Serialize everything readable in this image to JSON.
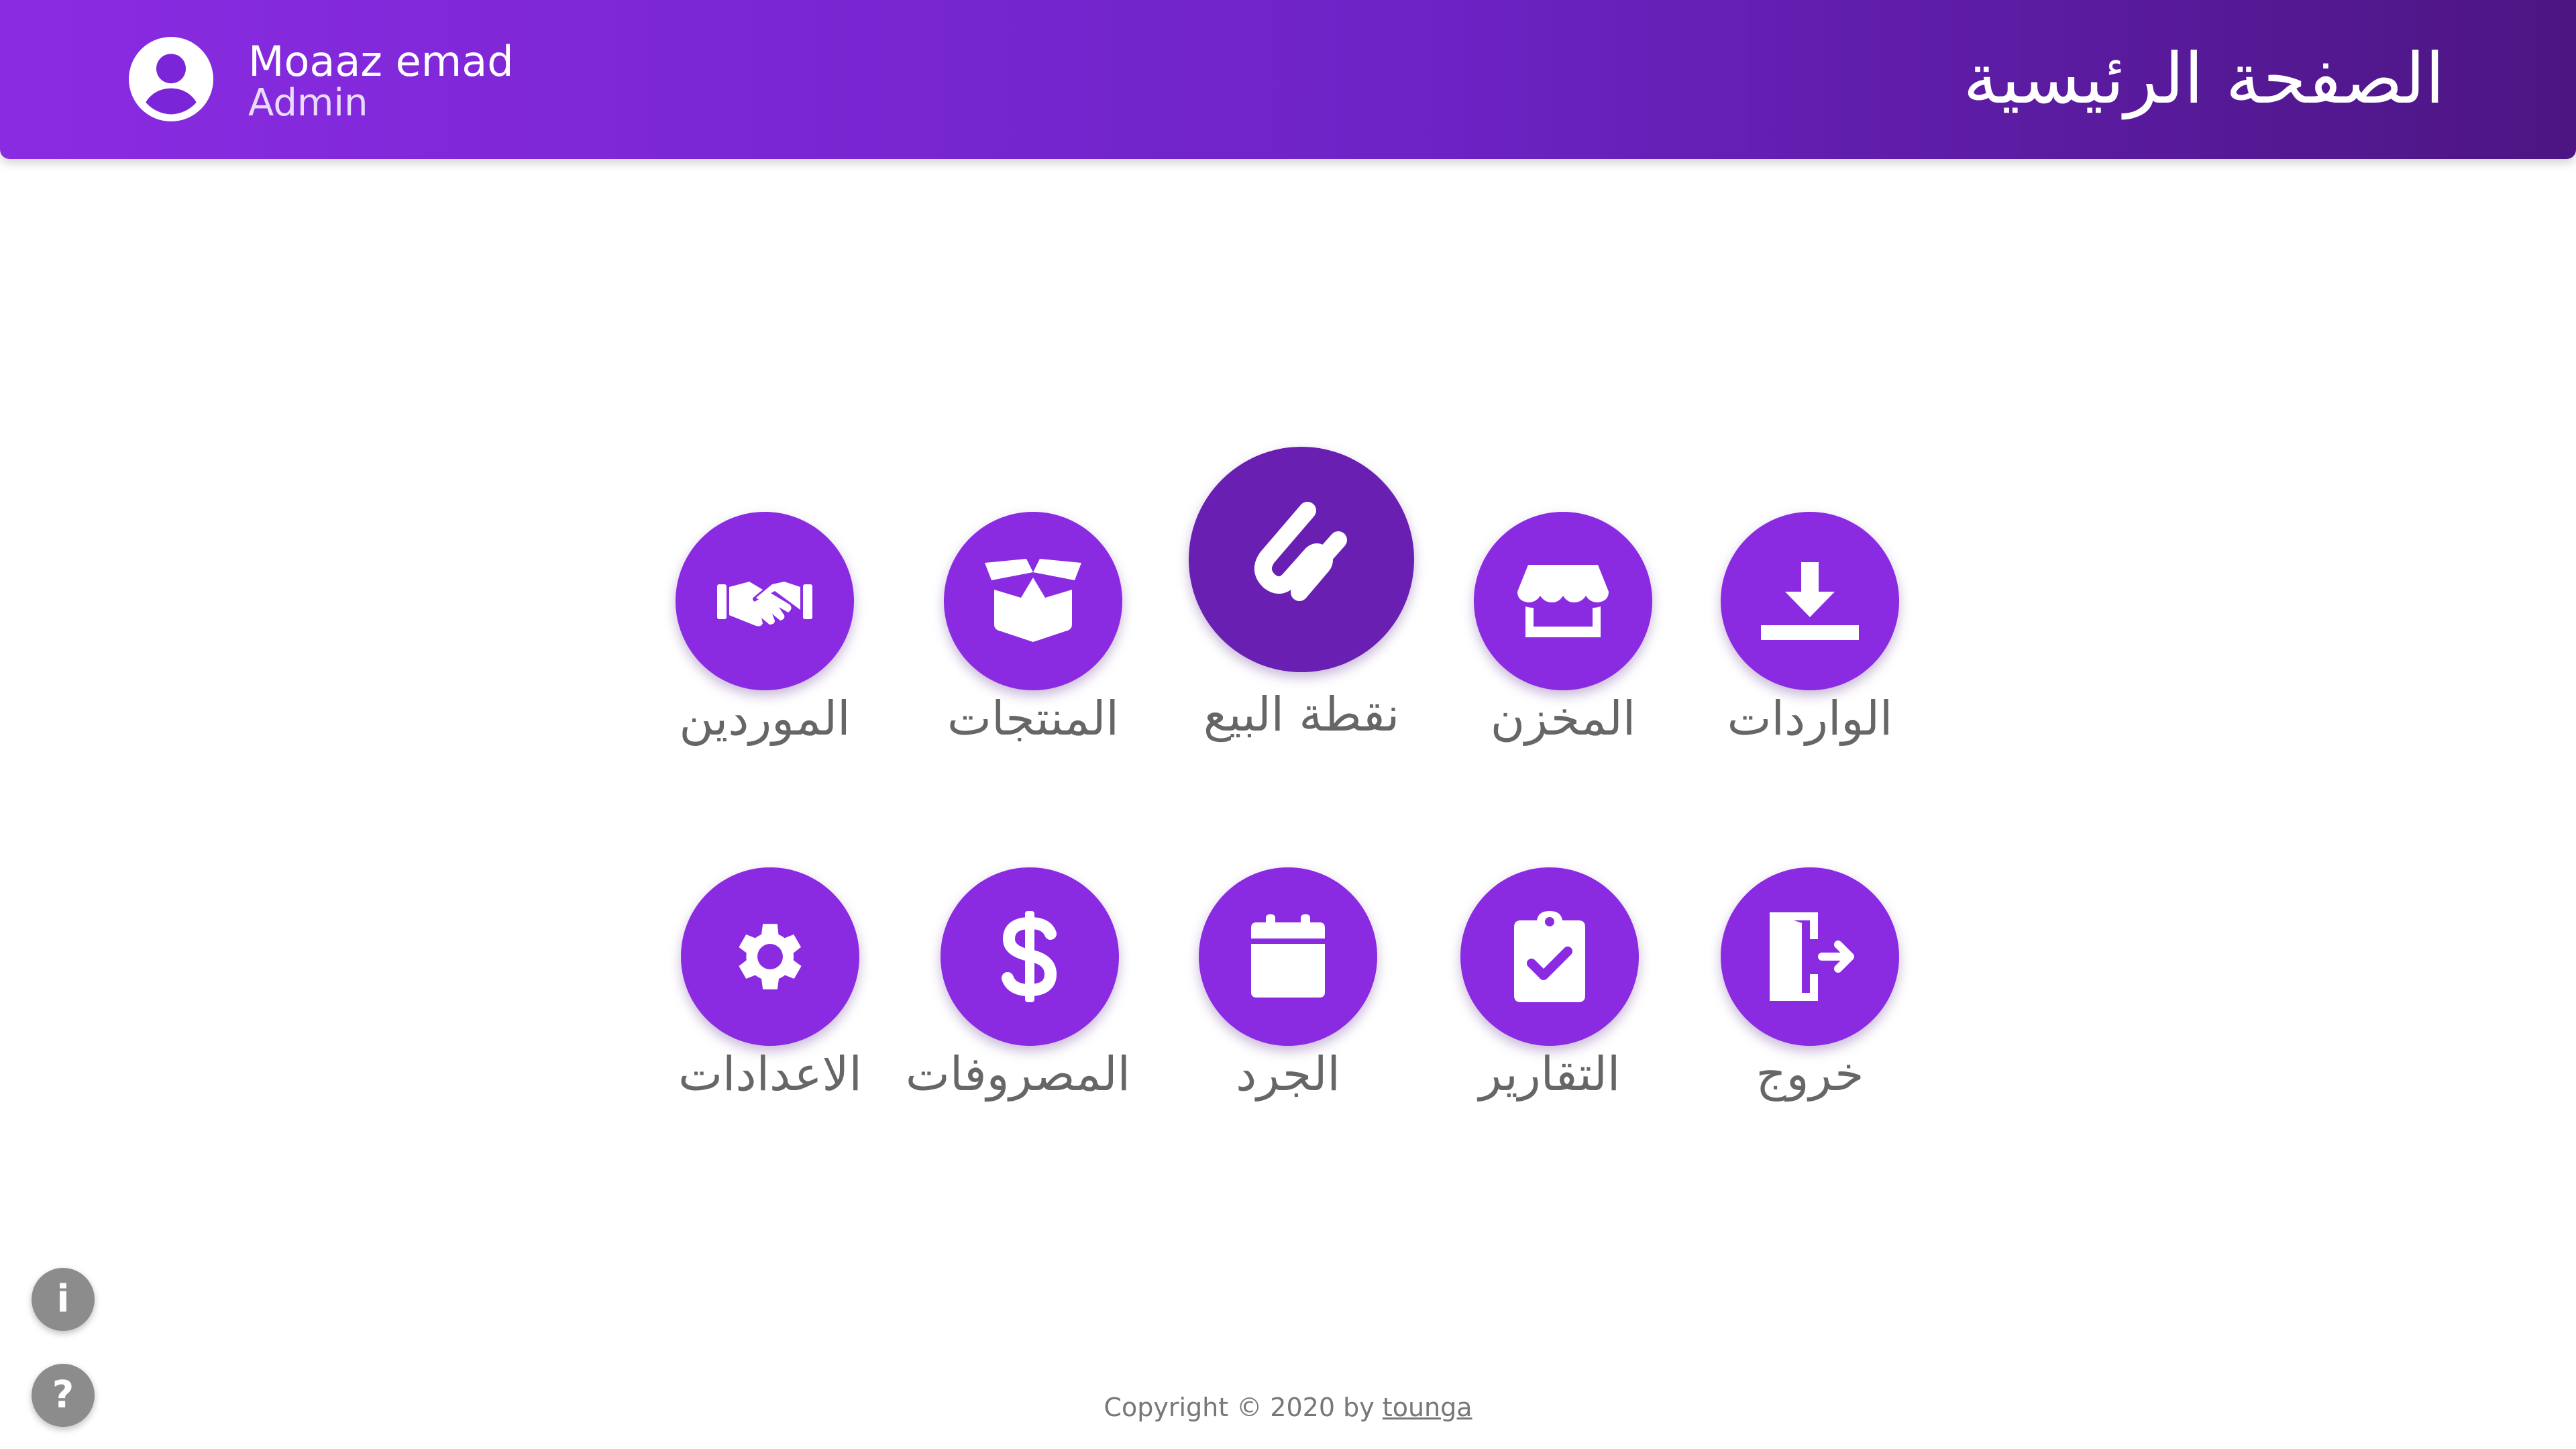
{
  "header": {
    "title": "الصفحة الرئيسية",
    "user": {
      "name": "Moaaz emad",
      "role": "Admin",
      "avatar_icon": "account-circle-icon"
    }
  },
  "tiles": [
    {
      "key": "suppliers",
      "label": "الموردين",
      "icon": "handshake-icon"
    },
    {
      "key": "products",
      "label": "المنتجات",
      "icon": "open-box-icon"
    },
    {
      "key": "pos",
      "label": "نقطة البيع",
      "icon": "pos-logo-icon",
      "highlighted": true
    },
    {
      "key": "store",
      "label": "المخزن",
      "icon": "store-icon"
    },
    {
      "key": "imports",
      "label": "الواردات",
      "icon": "download-icon"
    },
    {
      "key": "settings",
      "label": "الاعدادات",
      "icon": "gear-icon"
    },
    {
      "key": "expenses",
      "label": "المصروفات",
      "icon": "dollar-icon"
    },
    {
      "key": "inventory",
      "label": "الجرد",
      "icon": "calendar-icon"
    },
    {
      "key": "reports",
      "label": "التقارير",
      "icon": "clipboard-check-icon"
    },
    {
      "key": "logout",
      "label": "خروج",
      "icon": "door-exit-icon"
    }
  ],
  "fabs": {
    "info_label": "i",
    "help_label": "?"
  },
  "footer": {
    "text": "Copyright © 2020 by",
    "link": "tounga"
  },
  "colors": {
    "accent": "#8a2be2",
    "accent_dark": "#6a1fb3",
    "header_end": "#4c1582",
    "label_text": "#666666"
  }
}
